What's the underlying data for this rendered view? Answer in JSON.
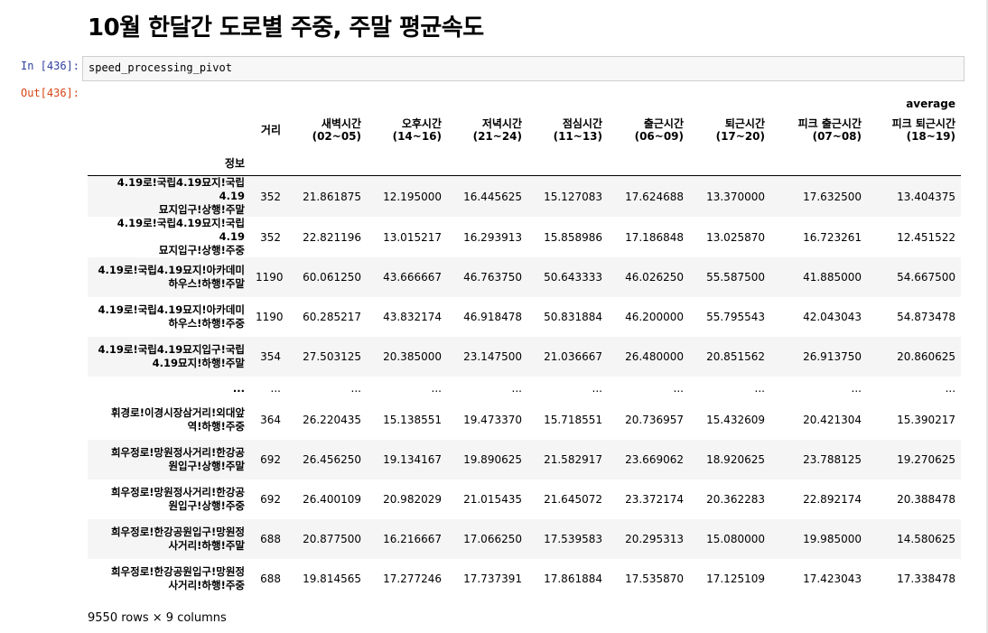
{
  "page_title": "10월 한달간 도로별 주중, 주말 평균속도",
  "cell": {
    "in_prompt": "In [436]:",
    "out_prompt": "Out[436]:",
    "code": "speed_processing_pivot"
  },
  "table": {
    "top_header": "average",
    "columns": [
      {
        "line1": "거리",
        "line2": ""
      },
      {
        "line1": "새벽시간",
        "line2": "(02~05)"
      },
      {
        "line1": "오후시간",
        "line2": "(14~16)"
      },
      {
        "line1": "저녁시간",
        "line2": "(21~24)"
      },
      {
        "line1": "점심시간",
        "line2": "(11~13)"
      },
      {
        "line1": "출근시간",
        "line2": "(06~09)"
      },
      {
        "line1": "퇴근시간",
        "line2": "(17~20)"
      },
      {
        "line1": "피크 출근시간",
        "line2": "(07~08)"
      },
      {
        "line1": "피크 퇴근시간",
        "line2": "(18~19)"
      }
    ],
    "index_name": "정보",
    "rows": [
      {
        "index1": "4.19로!국립4.19묘지!국립4.19",
        "index2": "묘지입구!상행!주말",
        "values": [
          "352",
          "21.861875",
          "12.195000",
          "16.445625",
          "15.127083",
          "17.624688",
          "13.370000",
          "17.632500",
          "13.404375"
        ]
      },
      {
        "index1": "4.19로!국립4.19묘지!국립4.19",
        "index2": "묘지입구!상행!주중",
        "values": [
          "352",
          "22.821196",
          "13.015217",
          "16.293913",
          "15.858986",
          "17.186848",
          "13.025870",
          "16.723261",
          "12.451522"
        ]
      },
      {
        "index1": "4.19로!국립4.19묘지!아카데미",
        "index2": "하우스!하행!주말",
        "values": [
          "1190",
          "60.061250",
          "43.666667",
          "46.763750",
          "50.643333",
          "46.026250",
          "55.587500",
          "41.885000",
          "54.667500"
        ]
      },
      {
        "index1": "4.19로!국립4.19묘지!아카데미",
        "index2": "하우스!하행!주중",
        "values": [
          "1190",
          "60.285217",
          "43.832174",
          "46.918478",
          "50.831884",
          "46.200000",
          "55.795543",
          "42.043043",
          "54.873478"
        ]
      },
      {
        "index1": "4.19로!국립4.19묘지입구!국립",
        "index2": "4.19묘지!하행!주말",
        "values": [
          "354",
          "27.503125",
          "20.385000",
          "23.147500",
          "21.036667",
          "26.480000",
          "20.851562",
          "26.913750",
          "20.860625"
        ]
      },
      {
        "index1": "...",
        "index2": "",
        "ellipsis": true,
        "values": [
          "...",
          "...",
          "...",
          "...",
          "...",
          "...",
          "...",
          "...",
          "..."
        ]
      },
      {
        "index1": "휘경로!이경시장삼거리!외대앞",
        "index2": "역!하행!주중",
        "values": [
          "364",
          "26.220435",
          "15.138551",
          "19.473370",
          "15.718551",
          "20.736957",
          "15.432609",
          "20.421304",
          "15.390217"
        ]
      },
      {
        "index1": "희우정로!망원정사거리!한강공",
        "index2": "원입구!상행!주말",
        "values": [
          "692",
          "26.456250",
          "19.134167",
          "19.890625",
          "21.582917",
          "23.669062",
          "18.920625",
          "23.788125",
          "19.270625"
        ]
      },
      {
        "index1": "희우정로!망원정사거리!한강공",
        "index2": "원입구!상행!주중",
        "values": [
          "692",
          "26.400109",
          "20.982029",
          "21.015435",
          "21.645072",
          "23.372174",
          "20.362283",
          "22.892174",
          "20.388478"
        ]
      },
      {
        "index1": "희우정로!한강공원입구!망원정",
        "index2": "사거리!하행!주말",
        "values": [
          "688",
          "20.877500",
          "16.216667",
          "17.066250",
          "17.539583",
          "20.295313",
          "15.080000",
          "19.985000",
          "14.580625"
        ]
      },
      {
        "index1": "희우정로!한강공원입구!망원정",
        "index2": "사거리!하행!주중",
        "values": [
          "688",
          "19.814565",
          "17.277246",
          "17.737391",
          "17.861884",
          "17.535870",
          "17.125109",
          "17.423043",
          "17.338478"
        ]
      }
    ],
    "footer": "9550 rows × 9 columns"
  }
}
